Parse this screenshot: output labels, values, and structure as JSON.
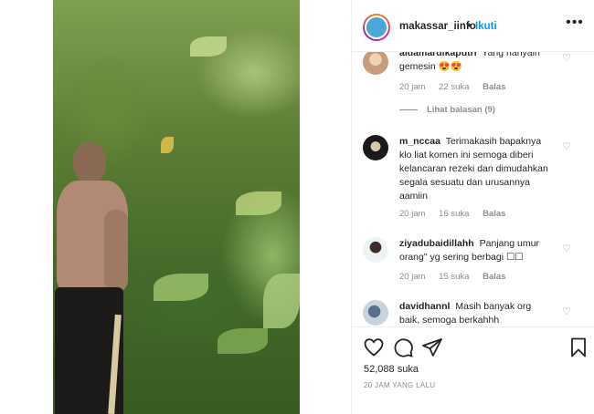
{
  "header": {
    "username": "makassar_iinfo",
    "separator": "•",
    "follow_label": "Ikuti",
    "more_icon": "more-horizontal-icon"
  },
  "comments": [
    {
      "username": "aidamardikaputri",
      "text": "Yang hanyain gemesin 😍😍",
      "time": "20 jam",
      "likes": "22 suka",
      "reply_label": "Balas",
      "view_replies": "Lihat balasan (9)"
    },
    {
      "username": "m_nccaa",
      "text": "Terimakasih bapaknya klo liat komen ini semoga diberi kelancaran rezeki dan dimudahkan segala sesuatu dan urusannya aamiin",
      "time": "20 jam",
      "likes": "16 suka",
      "reply_label": "Balas"
    },
    {
      "username": "ziyadubaidillahh",
      "text": "Panjang umur orang\" yg sering berbagi ☐☐",
      "time": "20 jam",
      "likes": "15 suka",
      "reply_label": "Balas"
    },
    {
      "username": "davidhannl",
      "text": "Masih banyak org baik, semoga berkahhh"
    }
  ],
  "actions": {
    "like_icon": "heart-icon",
    "comment_icon": "comment-icon",
    "share_icon": "share-icon",
    "save_icon": "bookmark-icon"
  },
  "likes_count": "52,088 suka",
  "timestamp": "20 JAM YANG LALU",
  "colors": {
    "accent": "#0095f6",
    "text": "#262626",
    "muted": "#8e8e8e",
    "border": "#efefef"
  }
}
